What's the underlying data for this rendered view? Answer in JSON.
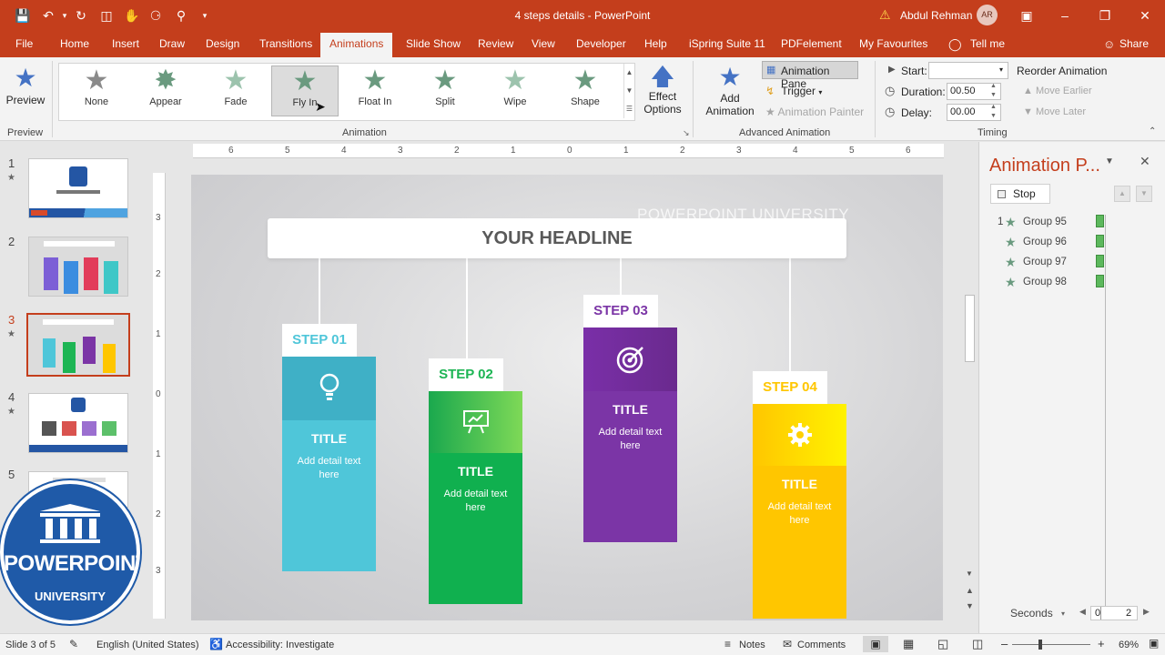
{
  "titlebar": {
    "doc_title": "4 steps details  -  PowerPoint",
    "user_name": "Abdul Rehman",
    "user_initials": "AR"
  },
  "menu": {
    "tabs": [
      "File",
      "Home",
      "Insert",
      "Draw",
      "Design",
      "Transitions",
      "Animations",
      "Slide Show",
      "Review",
      "View",
      "Developer",
      "Help",
      "iSpring Suite 11",
      "PDFelement",
      "My Favourites",
      "Tell me"
    ],
    "active_tab": "Animations",
    "share": "Share"
  },
  "ribbon": {
    "preview_label": "Preview",
    "preview_group": "Preview",
    "animations": [
      "None",
      "Appear",
      "Fade",
      "Fly In",
      "Float In",
      "Split",
      "Wipe",
      "Shape"
    ],
    "animation_group": "Animation",
    "effect_options": [
      "Effect",
      "Options"
    ],
    "add_animation": [
      "Add",
      "Animation"
    ],
    "animation_pane": "Animation Pane",
    "trigger": "Trigger",
    "animation_painter": "Animation Painter",
    "advanced_group": "Advanced Animation",
    "start_label": "Start:",
    "start_value": "",
    "duration_label": "Duration:",
    "duration_value": "00.50",
    "delay_label": "Delay:",
    "delay_value": "00.00",
    "reorder": "Reorder Animation",
    "move_earlier": "Move Earlier",
    "move_later": "Move Later",
    "timing_group": "Timing"
  },
  "thumbnails": [
    {
      "num": "1",
      "has_anim": true
    },
    {
      "num": "2",
      "has_anim": false
    },
    {
      "num": "3",
      "has_anim": true
    },
    {
      "num": "4",
      "has_anim": true
    },
    {
      "num": "5",
      "has_anim": false
    }
  ],
  "ruler": {
    "h_ticks": [
      "6",
      "5",
      "4",
      "3",
      "2",
      "1",
      "0",
      "1",
      "2",
      "3",
      "4",
      "5",
      "6"
    ],
    "v_ticks": [
      "3",
      "2",
      "1",
      "0",
      "1",
      "2",
      "3"
    ]
  },
  "slide": {
    "headline": "YOUR HEADLINE",
    "watermark": "POWERPOINT UNIVERSITY",
    "steps": [
      {
        "tag": "STEP 01",
        "title": "TITLE",
        "detail": "Add detail text here",
        "color": "#4fc6d9",
        "icon": "lightbulb-icon"
      },
      {
        "tag": "STEP 02",
        "title": "TITLE",
        "detail": "Add detail text here",
        "color": "#1db554",
        "icon": "presentation-board-icon"
      },
      {
        "tag": "STEP 03",
        "title": "TITLE",
        "detail": "Add detail text here",
        "color": "#7b35a6",
        "icon": "target-icon"
      },
      {
        "tag": "STEP 04",
        "title": "TITLE",
        "detail": "Add detail text here",
        "color": "#ffc600",
        "icon": "gear-icon"
      }
    ]
  },
  "animation_pane": {
    "title": "Animation P...",
    "stop": "Stop",
    "items": [
      {
        "num": "1",
        "name": "Group 95"
      },
      {
        "num": "",
        "name": "Group 96"
      },
      {
        "num": "",
        "name": "Group 97"
      },
      {
        "num": "",
        "name": "Group 98"
      }
    ],
    "seconds": "Seconds",
    "timeline_start": "0",
    "timeline_end": "2"
  },
  "statusbar": {
    "slide_info": "Slide 3 of 5",
    "language": "English (United States)",
    "accessibility": "Accessibility: Investigate",
    "notes": "Notes",
    "comments": "Comments",
    "zoom": "69%"
  },
  "logo": {
    "word": "POWERPOINT",
    "sub": "UNIVERSITY"
  },
  "colors": {
    "accent": "#c43e1c",
    "ribbon_bg": "#f3f3f3"
  }
}
